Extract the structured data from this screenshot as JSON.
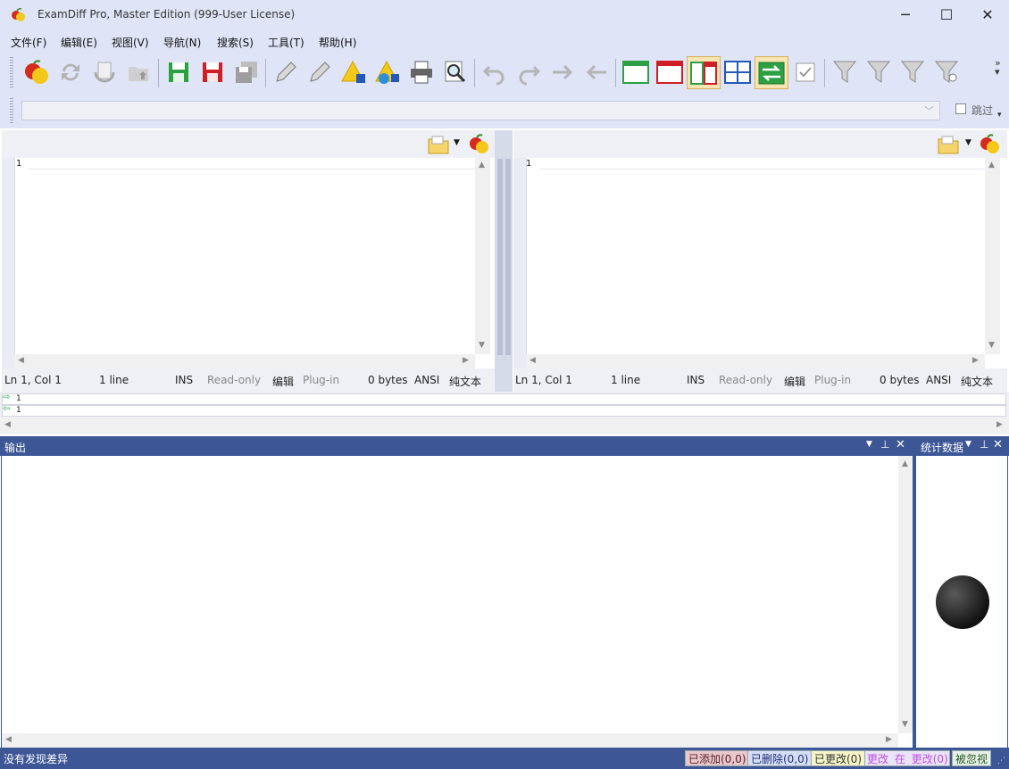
{
  "window": {
    "title": "ExamDiff Pro, Master Edition (999-User License)",
    "minimize": "─",
    "maximize": "☐",
    "close": "✕"
  },
  "menu": [
    "文件(F)",
    "编辑(E)",
    "视图(V)",
    "导航(N)",
    "搜索(S)",
    "工具(T)",
    "帮助(H)"
  ],
  "path_bar": {
    "skip_label": "跳过"
  },
  "left_pane": {
    "line_number": "1",
    "status": {
      "position": "Ln 1, Col 1",
      "lines": "1 line",
      "mode": "INS",
      "readonly": "Read-only",
      "edit": "编辑",
      "plugin": "Plug-in",
      "size": "0 bytes",
      "encoding": "ANSI",
      "type": "纯文本"
    }
  },
  "right_pane": {
    "line_number": "1",
    "status": {
      "position": "Ln 1, Col 1",
      "lines": "1 line",
      "mode": "INS",
      "readonly": "Read-only",
      "edit": "编辑",
      "plugin": "Plug-in",
      "size": "0 bytes",
      "encoding": "ANSI",
      "type": "纯文本"
    }
  },
  "diff_strip": {
    "left_line": "1",
    "right_line": "1"
  },
  "output_panel": {
    "title": "输出"
  },
  "stats_panel": {
    "title": "统计数据"
  },
  "statusbar": {
    "message": "没有发现差异",
    "added": "已添加(0,0)",
    "deleted": "已删除(0,0)",
    "changed": "已更改(0)",
    "changed_in_changed_a": "更改",
    "changed_in_changed_b": "在",
    "changed_in_changed_c": "更改(0)",
    "ignored": "被忽视"
  },
  "colors": {
    "chrome": "#dfe5f7",
    "dock_header": "#3d5796",
    "added_badge": "#e8c8cc",
    "deleted_badge": "#d6def5",
    "changed_badge": "#f6f5c8",
    "ignored_badge": "#e6f0e6"
  }
}
